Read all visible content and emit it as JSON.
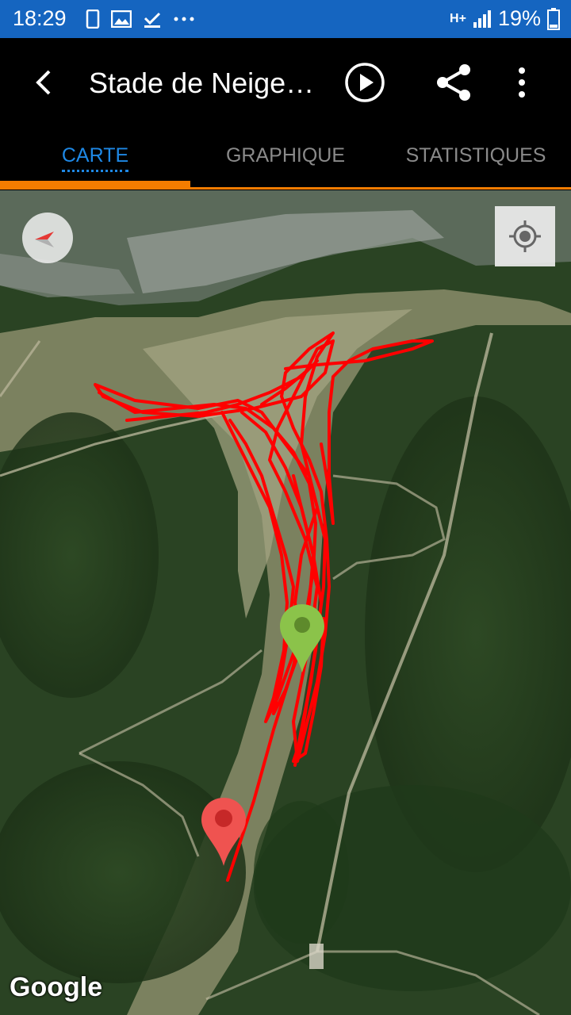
{
  "status_bar": {
    "time": "18:29",
    "network": "H+",
    "battery": "19%"
  },
  "toolbar": {
    "title": "Stade de Neige…"
  },
  "tabs": [
    {
      "label": "CARTE",
      "active": true
    },
    {
      "label": "GRAPHIQUE",
      "active": false
    },
    {
      "label": "STATISTIQUES",
      "active": false
    }
  ],
  "map": {
    "attribution": "Google",
    "track_color": "#ff0000",
    "start_marker_color": "#8bc34a",
    "end_marker_color": "#e53935"
  },
  "colors": {
    "accent": "#1e88e5",
    "tab_indicator": "#f57c00",
    "status_bar": "#1565c0"
  }
}
